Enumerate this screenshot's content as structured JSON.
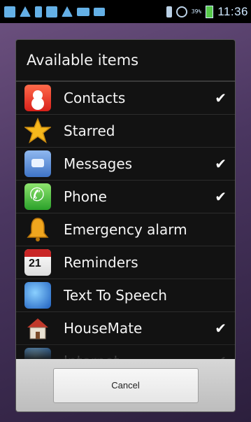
{
  "status_bar": {
    "battery_percent": "39%",
    "time": "11:36",
    "icons": [
      "notification-icon",
      "warning-icon",
      "usb-icon",
      "sim-icon",
      "warning-icon",
      "mail-icon",
      "message-icon",
      "bluetooth-icon",
      "no-signal-icon",
      "battery-icon"
    ]
  },
  "dialog": {
    "title": "Available items",
    "items": [
      {
        "label": "Contacts",
        "checked": true,
        "icon": "contacts-icon"
      },
      {
        "label": "Starred",
        "checked": false,
        "icon": "star-icon"
      },
      {
        "label": "Messages",
        "checked": true,
        "icon": "messages-icon"
      },
      {
        "label": "Phone",
        "checked": true,
        "icon": "phone-icon"
      },
      {
        "label": "Emergency alarm",
        "checked": false,
        "icon": "bell-icon"
      },
      {
        "label": "Reminders",
        "checked": false,
        "icon": "calendar-icon"
      },
      {
        "label": "Text To Speech",
        "checked": false,
        "icon": "speech-icon"
      },
      {
        "label": "HouseMate",
        "checked": true,
        "icon": "house-icon"
      },
      {
        "label": "Internet",
        "checked": true,
        "icon": "globe-icon"
      }
    ],
    "check_mark": "✔",
    "cancel_label": "Cancel"
  }
}
